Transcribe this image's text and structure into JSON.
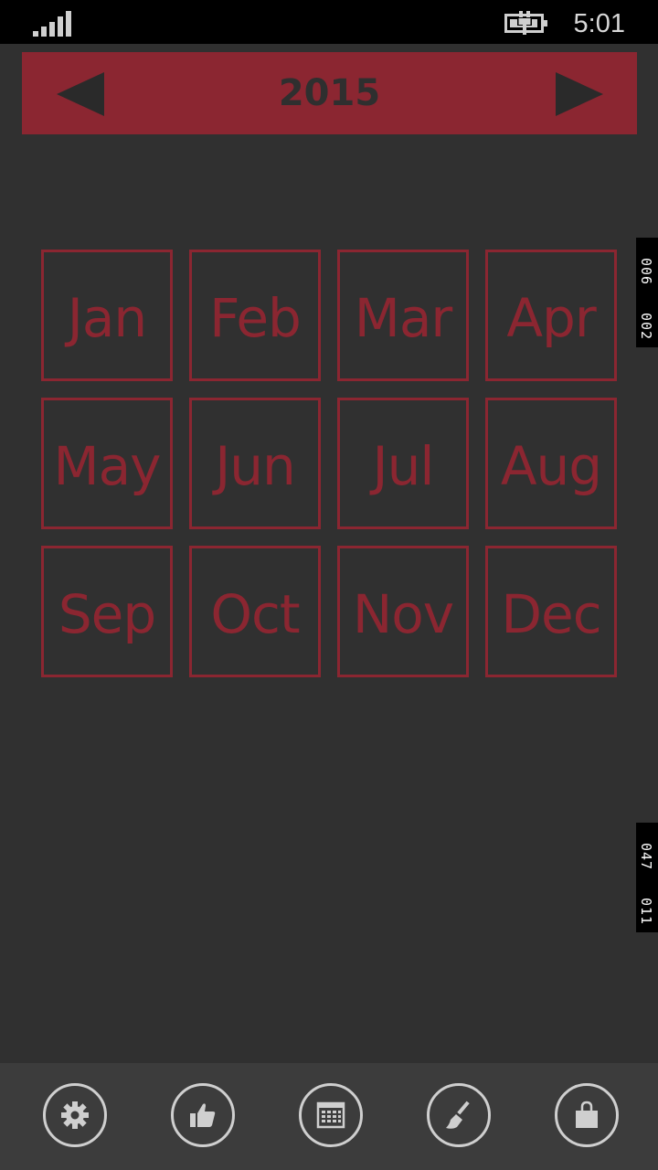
{
  "status_bar": {
    "time": "5:01",
    "signal_icon": "signal-bars-icon",
    "battery_icon": "battery-charging-icon"
  },
  "header": {
    "year": "2015",
    "prev_icon": "triangle-left-icon",
    "next_icon": "triangle-right-icon",
    "color": "#8b2631"
  },
  "months": [
    "Jan",
    "Feb",
    "Mar",
    "Apr",
    "May",
    "Jun",
    "Jul",
    "Aug",
    "Sep",
    "Oct",
    "Nov",
    "Dec"
  ],
  "side_markers": [
    {
      "a": "006",
      "b": "002"
    },
    {
      "a": "047",
      "b": "011"
    }
  ],
  "app_bar": {
    "buttons": [
      {
        "icon": "gear-icon"
      },
      {
        "icon": "thumbs-up-icon"
      },
      {
        "icon": "calendar-icon"
      },
      {
        "icon": "brush-icon"
      },
      {
        "icon": "shopping-bag-icon"
      }
    ]
  },
  "colors": {
    "accent": "#8b2631",
    "background": "#303030",
    "app_bar": "#3c3c3c"
  }
}
